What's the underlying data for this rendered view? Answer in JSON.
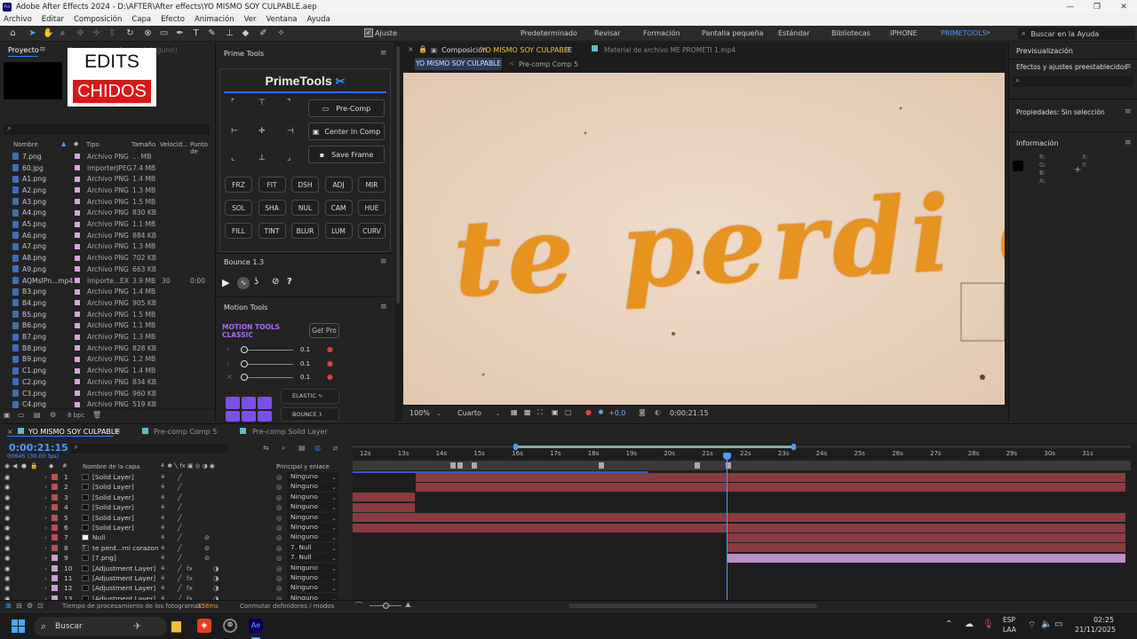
{
  "titlebar": {
    "title": "Adobe After Effects 2024 - D:\\AFTER\\After effects\\YO MISMO SOY CULPABLE.aep",
    "minimize": "—",
    "maximize": "❐",
    "close": "✕"
  },
  "menu": [
    "Archivo",
    "Editar",
    "Composición",
    "Capa",
    "Efecto",
    "Animación",
    "Ver",
    "Ventana",
    "Ayuda"
  ],
  "toolbar": {
    "ajuste": "Ajuste",
    "workspaces": [
      "Predeterminado",
      "Revisar",
      "Formación",
      "Pantalla pequeña",
      "Estándar",
      "Bibliotecas",
      "IPHONE",
      "PRIMETOOLS"
    ],
    "active_workspace": "PRIMETOOLS",
    "search_placeholder": "Buscar en la Ayuda"
  },
  "project": {
    "tab": "Proyecto",
    "ghost_tab": "Controles de efectos (ninguno)",
    "logo_top": "EDITS",
    "logo_bottom": "CHIDOS",
    "headers": {
      "name": "Nombre",
      "type": "Tipo",
      "size": "Tamaño",
      "speed": "Velocid...",
      "point": "Punto de"
    },
    "items": [
      {
        "name": "7.png",
        "type": "Archivo PNG",
        "size": "... MB"
      },
      {
        "name": "60.jpg",
        "type": "ImporterJPEG",
        "size": "7.4 MB"
      },
      {
        "name": "A1.png",
        "type": "Archivo PNG",
        "size": "1.4 MB"
      },
      {
        "name": "A2.png",
        "type": "Archivo PNG",
        "size": "1.3 MB"
      },
      {
        "name": "A3.png",
        "type": "Archivo PNG",
        "size": "1.5 MB"
      },
      {
        "name": "A4.png",
        "type": "Archivo PNG",
        "size": "830 KB"
      },
      {
        "name": "A5.png",
        "type": "Archivo PNG",
        "size": "1.1 MB"
      },
      {
        "name": "A6.png",
        "type": "Archivo PNG",
        "size": "884 KB"
      },
      {
        "name": "A7.png",
        "type": "Archivo PNG",
        "size": "1.3 MB"
      },
      {
        "name": "A8.png",
        "type": "Archivo PNG",
        "size": "702 KB"
      },
      {
        "name": "A9.png",
        "type": "Archivo PNG",
        "size": "663 KB"
      },
      {
        "name": "AQMsIPn...mp4",
        "type": "Importe...EX",
        "size": "3.9 MB",
        "speed": "30",
        "point": "0:00"
      },
      {
        "name": "B3.png",
        "type": "Archivo PNG",
        "size": "1.4 MB"
      },
      {
        "name": "B4.png",
        "type": "Archivo PNG",
        "size": "905 KB"
      },
      {
        "name": "B5.png",
        "type": "Archivo PNG",
        "size": "1.5 MB"
      },
      {
        "name": "B6.png",
        "type": "Archivo PNG",
        "size": "1.1 MB"
      },
      {
        "name": "B7.png",
        "type": "Archivo PNG",
        "size": "1.3 MB"
      },
      {
        "name": "B8.png",
        "type": "Archivo PNG",
        "size": "828 KB"
      },
      {
        "name": "B9.png",
        "type": "Archivo PNG",
        "size": "1.2 MB"
      },
      {
        "name": "C1.png",
        "type": "Archivo PNG",
        "size": "1.4 MB"
      },
      {
        "name": "C2.png",
        "type": "Archivo PNG",
        "size": "834 KB"
      },
      {
        "name": "C3.png",
        "type": "Archivo PNG",
        "size": "960 KB"
      },
      {
        "name": "C4.png",
        "type": "Archivo PNG",
        "size": "519 KB"
      }
    ],
    "bpc": "8 bpc"
  },
  "prime": {
    "tab": "Prime Tools",
    "title": "PrimeTools",
    "precomp": "Pre-Comp",
    "center": "Center In Comp",
    "save": "Save Frame",
    "buttons": [
      "FRZ",
      "FIT",
      "DSH",
      "ADJ",
      "MIR",
      "SOL",
      "SHA",
      "NUL",
      "CAM",
      "HUE",
      "FILL",
      "TINT",
      "BLUR",
      "LUM",
      "CURV"
    ],
    "bounce_tab": "Bounce 1.3",
    "motion_tab": "Motion Tools",
    "motion_logo1": "MOTION TOOLS",
    "motion_logo2": "CLASSIC",
    "get_pro": "Get Pro",
    "slider_vals": [
      "0.1",
      "0.1",
      "0.1"
    ],
    "elastic": "ELASTIC",
    "bounce": "BOUNCE"
  },
  "viewer": {
    "comp_tab_prefix": "Composición",
    "comp_name": "YO MISMO SOY CULPABLE",
    "footage_tab": "Material de archivo  ME PROMETI 1.mp4",
    "subtab1": "YO MISMO SOY CULPABLE",
    "subtab2": "Pre-comp Comp 5",
    "canvas_text": "te perdi en",
    "zoom": "100%",
    "quality": "Cuarto",
    "exposure": "+0,0",
    "time": "0:00:21:15"
  },
  "right": {
    "preview": "Previsualización",
    "effects": "Efectos y ajustes preestablecidos",
    "props": "Propiedades: Sin selección",
    "info": "Información",
    "rgba": [
      "R:",
      "G:",
      "B:",
      "A:"
    ],
    "xy": [
      "X:",
      "Y:"
    ]
  },
  "timeline": {
    "tabs": [
      "YO MISMO SOY CULPABLE",
      "Pre-comp Comp 5",
      "Pre-comp Solid Layer"
    ],
    "timecode": "0:00:21:15",
    "frames": "00645 (30.00 fps)",
    "col_name": "Nombre de la capa",
    "col_parent": "Principal y enlace",
    "ruler": [
      "12s",
      "13s",
      "14s",
      "15s",
      "16s",
      "17s",
      "18s",
      "19s",
      "20s",
      "21s",
      "22s",
      "23s",
      "24s",
      "25s",
      "26s",
      "27s",
      "28s",
      "29s",
      "30s",
      "31s"
    ],
    "layers": [
      {
        "num": "1",
        "name": "[Solid Layer]",
        "parent": "Ninguno",
        "color": "#b84f54"
      },
      {
        "num": "2",
        "name": "[Solid Layer]",
        "parent": "Ninguno",
        "color": "#b84f54"
      },
      {
        "num": "3",
        "name": "[Solid Layer]",
        "parent": "Ninguno",
        "color": "#b84f54"
      },
      {
        "num": "4",
        "name": "[Solid Layer]",
        "parent": "Ninguno",
        "color": "#b84f54"
      },
      {
        "num": "5",
        "name": "[Solid Layer]",
        "parent": "Ninguno",
        "color": "#b84f54"
      },
      {
        "num": "6",
        "name": "[Solid Layer]",
        "parent": "Ninguno",
        "color": "#b84f54"
      },
      {
        "num": "7",
        "name": "Null",
        "parent": "Ninguno",
        "color": "#b84f54"
      },
      {
        "num": "8",
        "name": "te perd...mi corazon",
        "parent": "7. Null",
        "color": "#b84f54"
      },
      {
        "num": "9",
        "name": "[7.png]",
        "parent": "7. Null",
        "color": "#c9a0d2"
      },
      {
        "num": "10",
        "name": "[Adjustment Layer]",
        "parent": "Ninguno",
        "color": "#c9a0d2"
      },
      {
        "num": "11",
        "name": "[Adjustment Layer]",
        "parent": "Ninguno",
        "color": "#c9a0d2"
      },
      {
        "num": "12",
        "name": "[Adjustment Layer]",
        "parent": "Ninguno",
        "color": "#c9a0d2"
      },
      {
        "num": "13",
        "name": "[Adjustment Layer]",
        "parent": "Ninguno",
        "color": "#c9a0d2"
      }
    ],
    "status": "Tiempo de procesamiento de los fotogramas:",
    "status_ms": "358ms",
    "toggle": "Conmutar definidores / modos"
  },
  "taskbar": {
    "search": "Buscar",
    "lang1": "ESP",
    "lang2": "LAA",
    "time": "02:25",
    "date": "21/11/2025"
  }
}
